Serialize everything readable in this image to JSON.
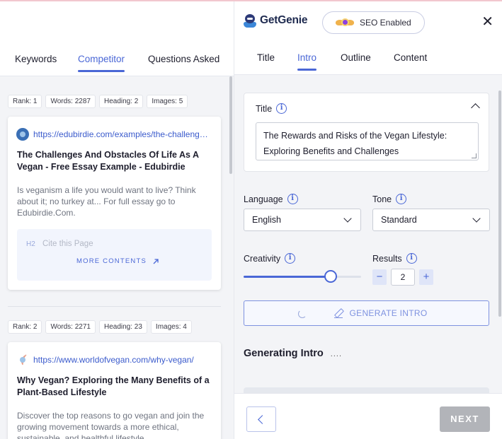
{
  "left_tabs": [
    {
      "label": "Keywords"
    },
    {
      "label": "Competitor"
    },
    {
      "label": "Questions Asked"
    }
  ],
  "competitors": [
    {
      "rank": "Rank: 1",
      "words": "Words: 2287",
      "heading": "Heading: 2",
      "images": "Images: 5",
      "url": "https://edubirdie.com/examples/the-challenges-and-obstacles-of-life-as-a-vegan/",
      "title": "The Challenges And Obstacles Of Life As A Vegan - Free Essay Example - Edubirdie",
      "description": "Is veganism a life you would want to live? Think about it; no turkey at... For full essay go to Edubirdie.Com.",
      "contents_tag": "H2",
      "contents_text": "Cite this Page",
      "more_label": "MORE CONTENTS"
    },
    {
      "rank": "Rank: 2",
      "words": "Words: 2271",
      "heading": "Heading: 23",
      "images": "Images: 4",
      "url": "https://www.worldofvegan.com/why-vegan/",
      "title": "Why Vegan? Exploring the Many Benefits of a Plant-Based Lifestyle",
      "description": "Discover the top reasons to go vegan and join the growing movement towards a more ethical, sustainable, and healthful lifestyle."
    }
  ],
  "brand": {
    "name": "GetGenie"
  },
  "seo_badge": {
    "label": "SEO Enabled"
  },
  "close_symbol": "✕",
  "right_tabs": [
    {
      "label": "Title"
    },
    {
      "label": "Intro"
    },
    {
      "label": "Outline"
    },
    {
      "label": "Content"
    }
  ],
  "title_section": {
    "label": "Title",
    "value": "The Rewards and Risks of the Vegan Lifestyle: Exploring Benefits and Challenges"
  },
  "language": {
    "label": "Language",
    "value": "English"
  },
  "tone": {
    "label": "Tone",
    "value": "Standard"
  },
  "creativity": {
    "label": "Creativity",
    "level_fraction": 0.74
  },
  "results": {
    "label": "Results",
    "value": "2",
    "minus": "−",
    "plus": "+"
  },
  "info_symbol": "i",
  "generate_button": {
    "label": "GENERATE INTRO"
  },
  "status": {
    "label": "Generating Intro",
    "dots": "...."
  },
  "footer": {
    "next_label": "NEXT"
  },
  "colors": {
    "accent": "#4a67d6",
    "disabled": "#b2b4b9",
    "panel_bg": "#f3f4f7"
  }
}
